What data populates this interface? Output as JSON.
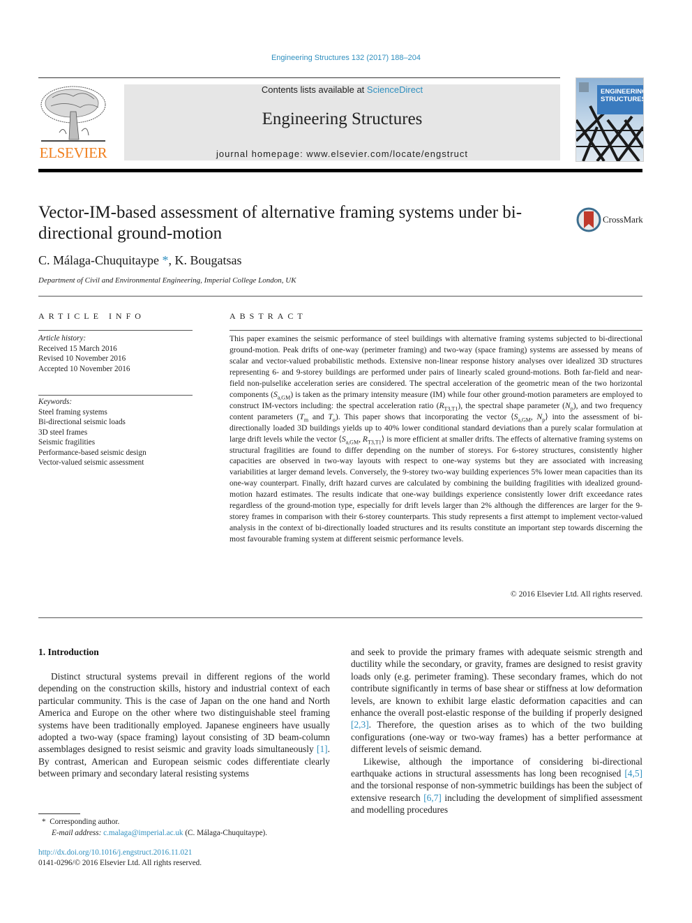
{
  "header": {
    "journal_ref": "Engineering Structures 132 (2017) 188–204",
    "contents_prefix": "Contents lists available at ",
    "contents_link": "ScienceDirect",
    "journal_name": "Engineering Structures",
    "homepage": "journal homepage: www.elsevier.com/locate/engstruct",
    "publisher_logo_text": "ELSEVIER",
    "cover_title_line1": "ENGINEERING",
    "cover_title_line2": "STRUCTURES",
    "brand_colors": {
      "elsevier_orange": "#f07f1d",
      "link_blue": "#2f8fbf",
      "cover_blue": "#3a7bbf"
    }
  },
  "article": {
    "title": "Vector-IM-based assessment of alternative framing systems under bi-directional ground-motion",
    "crossmark_label": "CrossMark",
    "author1": "C. Málaga-Chuquitaype",
    "author_star": "*",
    "author_sep": ", ",
    "author2": "K. Bougatsas",
    "affiliation": "Department of Civil and Environmental Engineering, Imperial College London, UK"
  },
  "article_info": {
    "heading": "ARTICLE INFO",
    "history_label": "Article history:",
    "history": [
      "Received 15 March 2016",
      "Revised 10 November 2016",
      "Accepted 10 November 2016"
    ],
    "keywords_label": "Keywords:",
    "keywords": [
      "Steel framing systems",
      "Bi-directional seismic loads",
      "3D steel frames",
      "Seismic fragilities",
      "Performance-based seismic design",
      "Vector-valued seismic assessment"
    ]
  },
  "abstract": {
    "heading": "ABSTRACT",
    "p1": "This paper examines the seismic performance of steel buildings with alternative framing systems subjected to bi-directional ground-motion. Peak drifts of one-way (perimeter framing) and two-way (space framing) systems are assessed by means of scalar and vector-valued probabilistic methods. Extensive non-linear response history analyses over idealized 3D structures representing 6- and 9-storey buildings are performed under pairs of linearly scaled ground-motions. Both far-field and near-field non-pulselike acceleration series are considered. The spectral acceleration of the geometric mean of the two horizontal components (",
    "sym_sa": "S",
    "sym_sa_sub": "a,GM",
    "p2": ") is taken as the primary intensity measure (IM) while four other ground-motion parameters are employed to construct IM-vectors including: the spectral acceleration ratio (",
    "sym_r": "R",
    "sym_r_sub": "T3,T1",
    "p3": "), the spectral shape parameter (",
    "sym_np": "N",
    "sym_np_sub": "p",
    "p4": "), and two frequency content parameters (",
    "sym_tm": "T",
    "sym_tm_sub": "m",
    "p5": " and ",
    "sym_to": "T",
    "sym_to_sub": "o",
    "p6": "). This paper shows that incorporating the vector ⟨",
    "p7": ", ",
    "p8": "⟩ into the assessment of bi-directionally loaded 3D buildings yields up to 40% lower conditional standard deviations than a purely scalar formulation at large drift levels while the vector ⟨",
    "p9": ", ",
    "p10": "⟩ is more efficient at smaller drifts. The effects of alternative framing systems on structural fragilities are found to differ depending on the number of storeys. For 6-storey structures, consistently higher capacities are observed in two-way layouts with respect to one-way systems but they are associated with increasing variabilities at larger demand levels. Conversely, the 9-storey two-way building experiences 5% lower mean capacities than its one-way counterpart. Finally, drift hazard curves are calculated by combining the building fragilities with idealized ground-motion hazard estimates. The results indicate that one-way buildings experience consistently lower drift exceedance rates regardless of the ground-motion type, especially for drift levels larger than 2% although the differences are larger for the 9-storey frames in comparison with their 6-storey counterparts. This study represents a first attempt to implement vector-valued analysis in the context of bi-directionally loaded structures and its results constitute an important step towards discerning the most favourable framing system at different seismic performance levels.",
    "copyright": "© 2016 Elsevier Ltd. All rights reserved."
  },
  "intro": {
    "heading": "1. Introduction",
    "left_p1a": "Distinct structural systems prevail in different regions of the world depending on the construction skills, history and industrial context of each particular community. This is the case of Japan on the one hand and North America and Europe on the other where two distinguishable steel framing systems have been traditionally employed. Japanese engineers have usually adopted a two-way (space framing) layout consisting of 3D beam-column assemblages designed to resist seismic and gravity loads simultaneously ",
    "cite1": "[1]",
    "left_p1b": ". By contrast, American and European seismic codes differentiate clearly between primary and secondary lateral resisting systems",
    "right_p1a": "and seek to provide the primary frames with adequate seismic strength and ductility while the secondary, or gravity, frames are designed to resist gravity loads only (e.g. perimeter framing). These secondary frames, which do not contribute significantly in terms of base shear or stiffness at low deformation levels, are known to exhibit large elastic deformation capacities and can enhance the overall post-elastic response of the building if properly designed ",
    "cite2": "[2,3]",
    "right_p1b": ". Therefore, the question arises as to which of the two building configurations (one-way or two-way frames) has a better performance at different levels of seismic demand.",
    "right_p2a": "Likewise, although the importance of considering bi-directional earthquake actions in structural assessments has long been recognised ",
    "cite3": "[4,5]",
    "right_p2b": " and the torsional response of non-symmetric buildings has been the subject of extensive research ",
    "cite4": "[6,7]",
    "right_p2c": " including the development of simplified assessment and modelling procedures"
  },
  "footnotes": {
    "star": "*",
    "corresponding": "Corresponding author.",
    "email_label": "E-mail address:",
    "email": "c.malaga@imperial.ac.uk",
    "email_owner": " (C. Málaga-Chuquitaype).",
    "doi": "http://dx.doi.org/10.1016/j.engstruct.2016.11.021",
    "issn_copyright": "0141-0296/© 2016 Elsevier Ltd. All rights reserved."
  }
}
